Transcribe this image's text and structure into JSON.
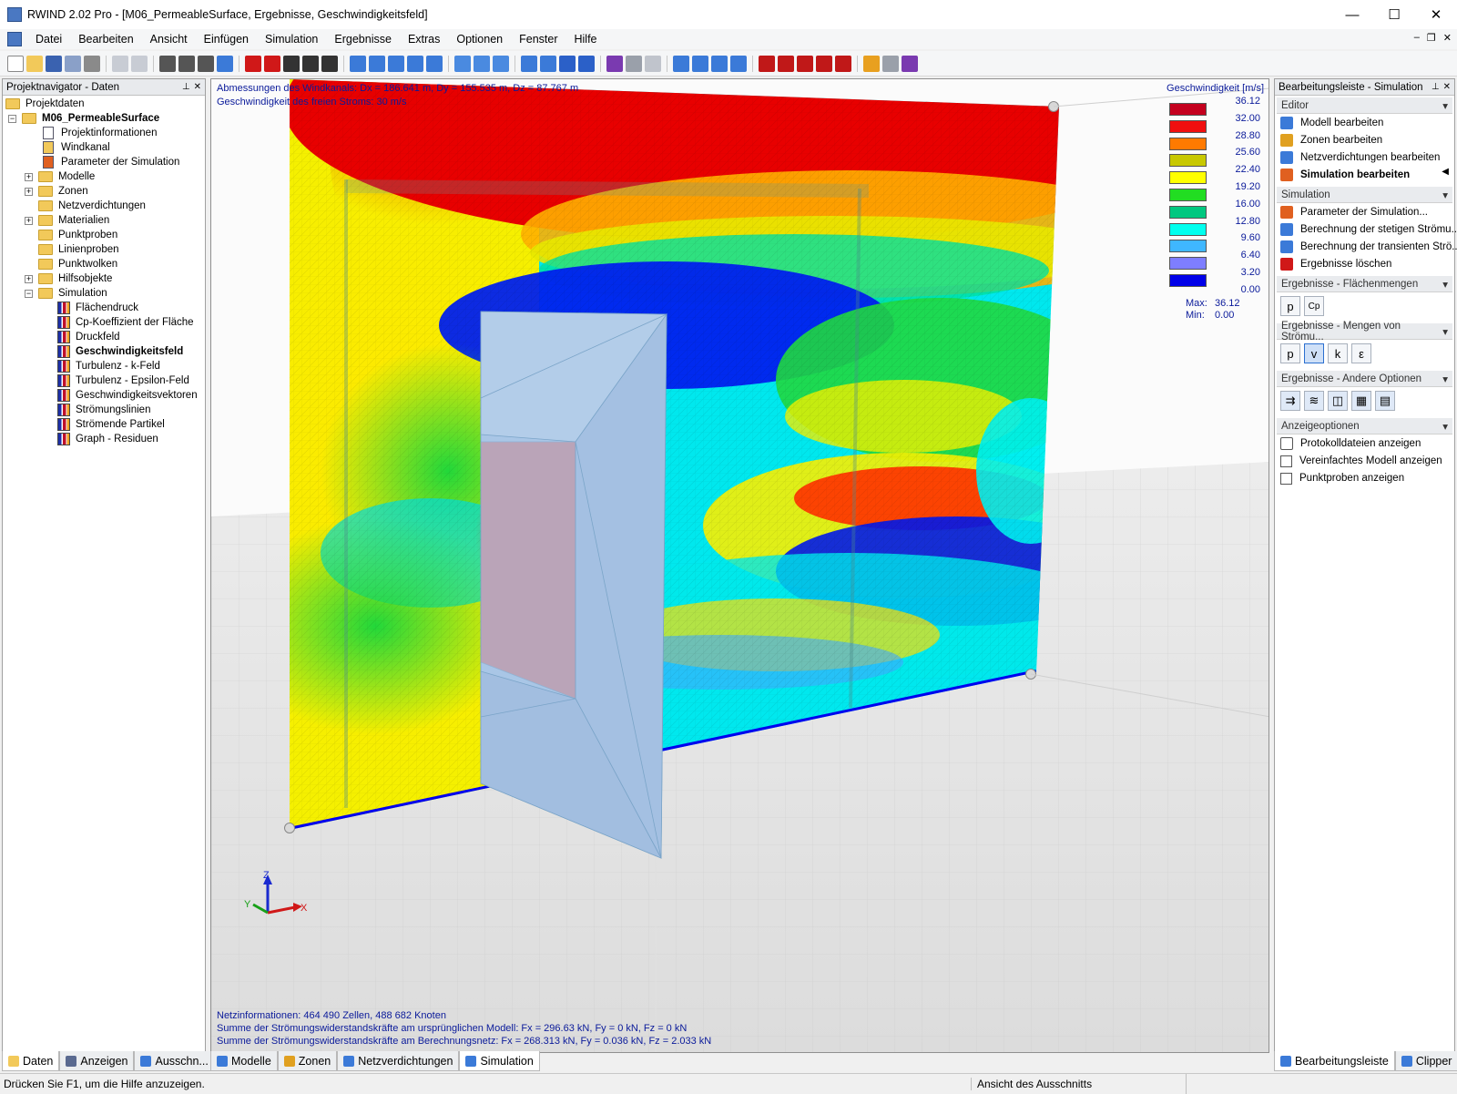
{
  "window": {
    "title": "RWIND 2.02 Pro - [M06_PermeableSurface, Ergebnisse, Geschwindigkeitsfeld]"
  },
  "menu": [
    "Datei",
    "Bearbeiten",
    "Ansicht",
    "Einfügen",
    "Simulation",
    "Ergebnisse",
    "Extras",
    "Optionen",
    "Fenster",
    "Hilfe"
  ],
  "navigator": {
    "title": "Projektnavigator - Daten",
    "root": "Projektdaten",
    "project": "M06_PermeableSurface",
    "items": [
      "Projektinformationen",
      "Windkanal",
      "Parameter der Simulation",
      "Modelle",
      "Zonen",
      "Netzverdichtungen",
      "Materialien",
      "Punktproben",
      "Linienproben",
      "Punktwolken",
      "Hilfsobjekte",
      "Simulation"
    ],
    "sim_items": [
      "Flächendruck",
      "Cp-Koeffizient der Fläche",
      "Druckfeld",
      "Geschwindigkeitsfeld",
      "Turbulenz - k-Feld",
      "Turbulenz - Epsilon-Feld",
      "Geschwindigkeitsvektoren",
      "Strömungslinien",
      "Strömende Partikel",
      "Graph - Residuen"
    ],
    "tabs": [
      "Daten",
      "Anzeigen",
      "Ausschn..."
    ]
  },
  "viewport": {
    "info_line1": "Abmessungen des Windkanals: Dx = 186.641 m, Dy = 155.535 m, Dz = 87.767 m",
    "info_line2": "Geschwindigkeit des freien Stroms: 30 m/s",
    "bottom1": "Netzinformationen: 464 490 Zellen, 488 682 Knoten",
    "bottom2": "Summe der Strömungswiderstandskräfte am ursprünglichen Modell: Fx = 296.63 kN, Fy = 0 kN, Fz = 0 kN",
    "bottom3": "Summe der Strömungswiderstandskräfte am Berechnungsnetz: Fx = 268.313 kN, Fy = 0.036 kN, Fz = 2.033 kN",
    "axis_x": "X",
    "axis_y": "Y",
    "axis_z": "Z"
  },
  "legend": {
    "title": "Geschwindigkeit [m/s]",
    "labels": [
      "36.12",
      "32.00",
      "28.80",
      "25.60",
      "22.40",
      "19.20",
      "16.00",
      "12.80",
      "9.60",
      "6.40",
      "3.20",
      "0.00"
    ],
    "colors": [
      "#c4001e",
      "#f00f0f",
      "#ff7a00",
      "#c8c800",
      "#ffff00",
      "#22dd22",
      "#00c880",
      "#00ffee",
      "#3fb7ff",
      "#7e7eff",
      "#0000e8"
    ],
    "max_label": "Max:",
    "max_value": "36.12",
    "min_label": "Min:",
    "min_value": "0.00"
  },
  "view_tabs": [
    "Modelle",
    "Zonen",
    "Netzverdichtungen",
    "Simulation"
  ],
  "right_panel": {
    "title": "Bearbeitungsleiste - Simulation",
    "editor_header": "Editor",
    "editor_items": [
      "Modell bearbeiten",
      "Zonen bearbeiten",
      "Netzverdichtungen bearbeiten",
      "Simulation bearbeiten"
    ],
    "sim_header": "Simulation",
    "sim_items": [
      "Parameter der Simulation...",
      "Berechnung der stetigen Strömu...",
      "Berechnung der transienten Strö...",
      "Ergebnisse löschen"
    ],
    "surf_header": "Ergebnisse - Flächenmengen",
    "surf_buttons": [
      "p",
      "Cp"
    ],
    "flow_header": "Ergebnisse - Mengen von Strömu...",
    "flow_buttons": [
      "p",
      "v",
      "k",
      "ε"
    ],
    "other_header": "Ergebnisse - Andere Optionen",
    "display_header": "Anzeigeoptionen",
    "display_items": [
      "Protokolldateien anzeigen",
      "Vereinfachtes Modell anzeigen",
      "Punktproben anzeigen"
    ],
    "tabs": [
      "Bearbeitungsleiste",
      "Clipper"
    ]
  },
  "status": {
    "help": "Drücken Sie F1, um die Hilfe anzuzeigen.",
    "view": "Ansicht des Ausschnitts"
  }
}
